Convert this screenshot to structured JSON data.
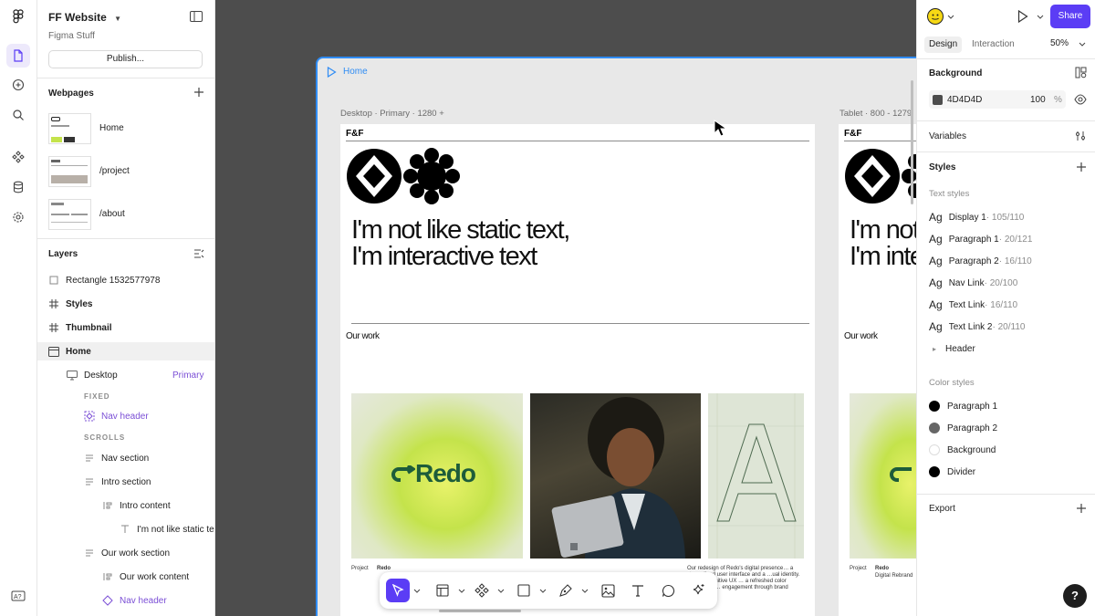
{
  "file": {
    "name": "FF Website",
    "project": "Figma Stuff",
    "publish_label": "Publish..."
  },
  "webpages": {
    "title": "Webpages",
    "pages": [
      {
        "label": "Home"
      },
      {
        "label": "/project"
      },
      {
        "label": "/about"
      }
    ]
  },
  "layers": {
    "title": "Layers",
    "items": [
      {
        "label": "Rectangle 1532577978"
      },
      {
        "label": "Styles"
      },
      {
        "label": "Thumbnail"
      },
      {
        "label": "Home"
      },
      {
        "label": "Desktop",
        "badge": "Primary"
      },
      {
        "label": "FIXED"
      },
      {
        "label": "Nav header"
      },
      {
        "label": "SCROLLS"
      },
      {
        "label": "Nav section"
      },
      {
        "label": "Intro section"
      },
      {
        "label": "Intro content"
      },
      {
        "label": "I'm not like static te"
      },
      {
        "label": "Our work section"
      },
      {
        "label": "Our work content"
      },
      {
        "label": "Nav header"
      }
    ]
  },
  "canvas": {
    "section_label": "Home",
    "desktop_label": "Desktop · Primary · 1280 +",
    "tablet_label": "Tablet · 800 - 1279",
    "logo": "F&F",
    "hero_line1": "I'm not like static text,",
    "hero_line2": "I'm interactive text",
    "tablet_hero_line1": "I'm not",
    "tablet_hero_line2": "I'm inte",
    "our_work": "Our work",
    "redo_word": "Redo",
    "caption_project": "Project",
    "caption_name": "Redo",
    "caption_desc": "Our redesign of Redo's digital presence… a streamlined user interface and a …ual identity. Through intuitive UX … a refreshed color palette, we … engagement through brand",
    "tablet_caption_name": "Redo",
    "tablet_caption_sub": "Digital Rebrand"
  },
  "right": {
    "share_label": "Share",
    "tabs": {
      "design": "Design",
      "interaction": "Interaction"
    },
    "zoom": "50%",
    "background": {
      "title": "Background",
      "hex": "4D4D4D",
      "opacity": "100",
      "percent": "%",
      "color": "#4D4D4D"
    },
    "variables_title": "Variables",
    "styles_title": "Styles",
    "text_styles_title": "Text styles",
    "text_styles": [
      {
        "ag": "Ag",
        "name": "Display 1",
        "meta": " · 105/110"
      },
      {
        "ag": "Ag",
        "name": "Paragraph 1",
        "meta": " · 20/121"
      },
      {
        "ag": "Ag",
        "name": "Paragraph 2",
        "meta": " · 16/110"
      },
      {
        "ag": "Ag",
        "name": "Nav Link",
        "meta": " · 20/100"
      },
      {
        "ag": "Ag",
        "name": "Text Link",
        "meta": " · 16/110"
      },
      {
        "ag": "Ag",
        "name": "Text Link 2",
        "meta": " · 20/110"
      }
    ],
    "header_group": "Header",
    "color_styles_title": "Color styles",
    "color_styles": [
      {
        "name": "Paragraph 1",
        "color": "#000000"
      },
      {
        "name": "Paragraph 2",
        "color": "#666666"
      },
      {
        "name": "Background",
        "color": "#FFFFFF"
      },
      {
        "name": "Divider",
        "color": "#000000"
      }
    ],
    "export_title": "Export",
    "help": "?"
  },
  "colors": {
    "accent": "#5B3DF5",
    "selection": "#2F8CF4",
    "canvas_bg": "#4D4D4D",
    "component": "#7B4FD6"
  }
}
